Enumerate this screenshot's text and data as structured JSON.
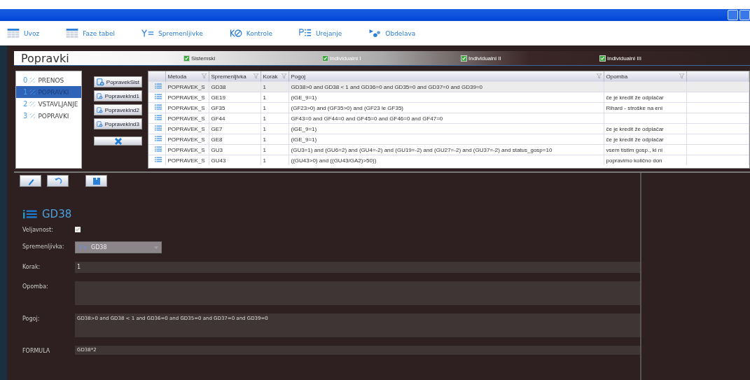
{
  "toolbar": [
    {
      "label": "Uvoz"
    },
    {
      "label": "Faze tabel"
    },
    {
      "label": "Spremenljivke"
    },
    {
      "label": "Kontrole"
    },
    {
      "label": "Urejanje"
    },
    {
      "label": "Obdelava"
    }
  ],
  "header": {
    "title": "Popravki",
    "filters": [
      {
        "label": "Sistemski",
        "checked": true
      },
      {
        "label": "Individualni I",
        "checked": true
      },
      {
        "label": "Individualni II",
        "checked": true
      },
      {
        "label": "Individualni III",
        "checked": true
      }
    ]
  },
  "steps": [
    {
      "number": "0",
      "label": "PRENOS",
      "selected": false
    },
    {
      "number": "1",
      "label": "POPRAVKI",
      "selected": true
    },
    {
      "number": "2",
      "label": "VSTAVLJANJE",
      "selected": false
    },
    {
      "number": "3",
      "label": "POPRAVKI",
      "selected": false
    }
  ],
  "add_buttons": [
    "PopravekSist",
    "PopravekInd1",
    "PopravekInd2",
    "PopravekInd3"
  ],
  "table": {
    "columns": [
      "Metoda",
      "Spremenljivka",
      "Korak",
      "Pogoj",
      "Opomba"
    ],
    "rows": [
      {
        "selected": true,
        "cells": [
          "POPRAVEK_S",
          "GD38",
          "1",
          "GD38>0 and  GD38 < 1 and GD36=0 and GD35=0 and GD37=0 and GD39=0",
          ""
        ]
      },
      {
        "selected": false,
        "cells": [
          "POPRAVEK_S",
          "GE19",
          "1",
          "(iGE_9=1)",
          "če je kredit že odplačar"
        ]
      },
      {
        "selected": false,
        "cells": [
          "POPRAVEK_S",
          "GF35",
          "1",
          "(GF23>0) and (GF35>0) and (GF23 le GF35)",
          "Rihard - stroške na eni"
        ]
      },
      {
        "selected": false,
        "cells": [
          "POPRAVEK_S",
          "GF44",
          "1",
          "GF43=0 and GF44=0 and GF45=0 and GF46=0 and GF47=0",
          ""
        ]
      },
      {
        "selected": false,
        "cells": [
          "POPRAVEK_S",
          "GE7",
          "1",
          "(iGE_9=1)",
          "če je kredit že odplačar"
        ]
      },
      {
        "selected": false,
        "cells": [
          "POPRAVEK_S",
          "GE8",
          "1",
          "(iGE_9=1)",
          "če je kredit že odplačar"
        ]
      },
      {
        "selected": false,
        "cells": [
          "POPRAVEK_S",
          "GU3",
          "1",
          "(GU3=1) and (GU6=2) and (GU4=-2) and (GU19=-2) and (GU27=-2) and (GU37=-2) and status_gosp=10",
          "vsem tistim gosp., ki ni"
        ]
      },
      {
        "selected": false,
        "cells": [
          "POPRAVEK_S",
          "GU43",
          "1",
          "((GU43>0) and ((GU43/GA2)>50))",
          "popravimo količno don"
        ]
      }
    ]
  },
  "form": {
    "title": "GD38",
    "validity": {
      "label": "Veljavnost:",
      "checked": true
    },
    "variable": {
      "label": "Spremenljivka:",
      "value": "GD38",
      "disabled": true
    },
    "step": {
      "label": "Korak:",
      "value": "1"
    },
    "note": {
      "label": "Opomba:"
    },
    "condition": {
      "label": "Pogoj:",
      "value": "GD38>0 and  GD38 < 1 and GD36=0 and GD35=0 and GD37=0 and GD39=0"
    },
    "formula": {
      "label": "FORMULA",
      "value": "GD38*2"
    }
  }
}
